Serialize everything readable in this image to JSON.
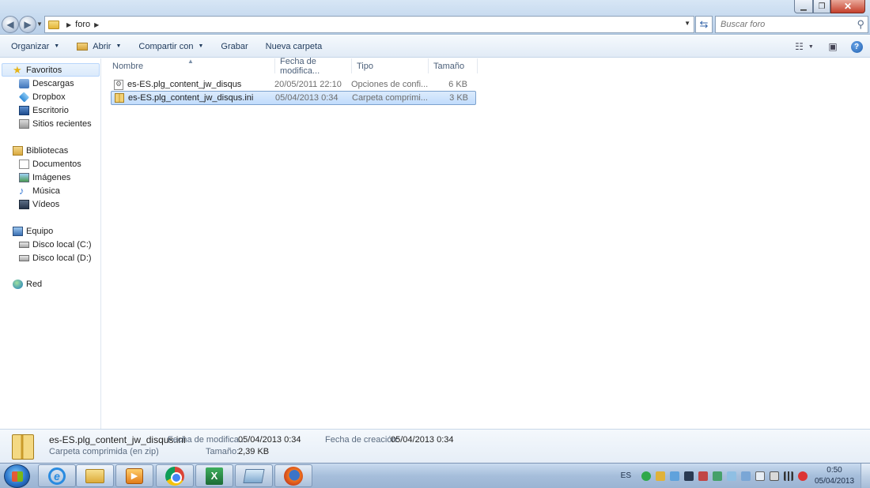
{
  "address": {
    "crumbs": [
      "foro"
    ],
    "search_placeholder": "Buscar foro"
  },
  "toolbar": {
    "organize": "Organizar",
    "open": "Abrir",
    "share": "Compartir con",
    "burn": "Grabar",
    "new_folder": "Nueva carpeta"
  },
  "nav": {
    "favorites": {
      "label": "Favoritos",
      "items": [
        "Descargas",
        "Dropbox",
        "Escritorio",
        "Sitios recientes"
      ]
    },
    "libraries": {
      "label": "Bibliotecas",
      "items": [
        "Documentos",
        "Imágenes",
        "Música",
        "Vídeos"
      ]
    },
    "computer": {
      "label": "Equipo",
      "items": [
        "Disco local (C:)",
        "Disco local (D:)"
      ]
    },
    "network": {
      "label": "Red"
    }
  },
  "columns": {
    "name": "Nombre",
    "date": "Fecha de modifica...",
    "type": "Tipo",
    "size": "Tamaño"
  },
  "files": [
    {
      "name": "es-ES.plg_content_jw_disqus",
      "date": "20/05/2011 22:10",
      "type": "Opciones de confi...",
      "size": "6 KB",
      "icon": "config-file-icon",
      "selected": false
    },
    {
      "name": "es-ES.plg_content_jw_disqus.ini",
      "date": "05/04/2013 0:34",
      "type": "Carpeta comprimi...",
      "size": "3 KB",
      "icon": "zip-folder-icon",
      "selected": true
    }
  ],
  "details": {
    "filename": "es-ES.plg_content_jw_disqus.ini",
    "filetype": "Carpeta comprimida (en zip)",
    "modified_label": "Fecha de modifica...",
    "modified_value": "05/04/2013 0:34",
    "size_label": "Tamaño:",
    "size_value": "2,39 KB",
    "created_label": "Fecha de creación:",
    "created_value": "05/04/2013 0:34"
  },
  "taskbar": {
    "apps": [
      "internet-explorer",
      "windows-explorer",
      "media-player",
      "chrome",
      "excel",
      "app",
      "firefox"
    ],
    "language": "ES",
    "time": "0:50",
    "date": "05/04/2013"
  },
  "colors": {
    "selection": "#cce4fc",
    "accent": "#1e395b"
  }
}
